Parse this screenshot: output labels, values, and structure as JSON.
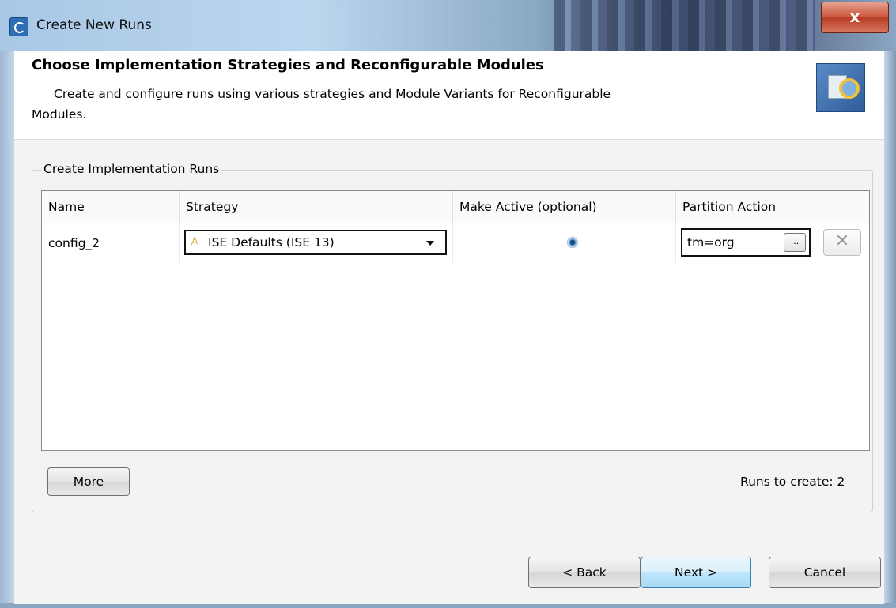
{
  "window": {
    "title": "Create New Runs",
    "close_glyph": "x"
  },
  "header": {
    "title": "Choose Implementation Strategies and Reconfigurable Modules",
    "description_line1": "Create and configure runs using various strategies and Module Variants for Reconfigurable",
    "description_line2": "Modules.",
    "icon": "create-runs-wizard-icon"
  },
  "group": {
    "label": "Create Implementation Runs"
  },
  "table": {
    "columns": [
      "Name",
      "Strategy",
      "Make Active (optional)",
      "Partition Action",
      ""
    ],
    "rows": [
      {
        "name": "config_2",
        "strategy": "ISE Defaults (ISE 13)",
        "make_active": true,
        "partition_action": "tm=org",
        "browse_label": "...",
        "delete_glyph": "✕"
      }
    ]
  },
  "buttons": {
    "more_label": "More",
    "back_label": "< Back",
    "next_label": "Next >",
    "cancel_label": "Cancel"
  },
  "status": {
    "runs_to_create": "Runs to create: 2"
  },
  "colors": {
    "dialog_bg": "#f3f3f3",
    "header_bg": "#ffffff",
    "default_button_border": "#3c7fb1"
  }
}
